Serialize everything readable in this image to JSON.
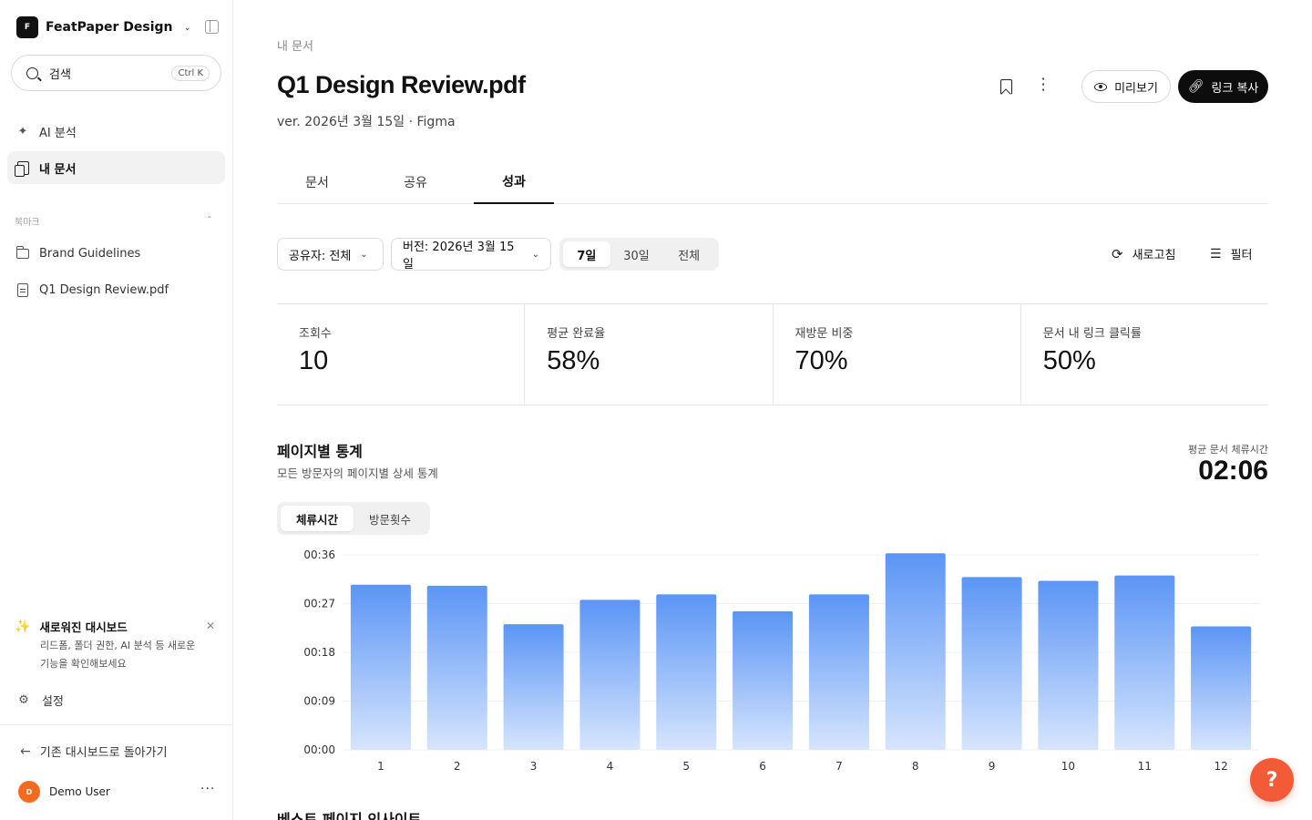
{
  "workspace": {
    "logo_letter": "F",
    "name": "FeatPaper Design"
  },
  "search": {
    "label": "검색",
    "shortcut": "Ctrl K"
  },
  "nav": {
    "ai": "AI 분석",
    "docs": "내 문서"
  },
  "bookmarks": {
    "label": "북마크",
    "items": [
      "Brand Guidelines",
      "Q1 Design Review.pdf"
    ]
  },
  "promo": {
    "title": "새로워진 대시보드",
    "desc": "리드폼, 폴더 권한, AI 분석 등 새로운 기능을 확인해보세요"
  },
  "settings_label": "설정",
  "back_label": "기존 대시보드로 돌아가기",
  "user": {
    "initial": "D",
    "name": "Demo User"
  },
  "page": {
    "breadcrumb": "내 문서",
    "title": "Q1 Design Review.pdf",
    "subtitle": "ver. 2026년 3월 15일 · Figma",
    "preview_label": "미리보기",
    "copy_link_label": "링크 복사"
  },
  "tabs": [
    "문서",
    "공유",
    "성과"
  ],
  "active_tab": "성과",
  "filters": {
    "sharer": "공유자: 전체",
    "version": "버전: 2026년 3월 15일",
    "periods": [
      "7일",
      "30일",
      "전체"
    ],
    "active_period": "7일",
    "refresh_label": "새로고침",
    "filter_label": "필터"
  },
  "stats": [
    {
      "label": "조회수",
      "value": "10"
    },
    {
      "label": "평균 완료율",
      "value": "58%"
    },
    {
      "label": "재방문 비중",
      "value": "70%"
    },
    {
      "label": "문서 내 링크 클릭률",
      "value": "50%"
    }
  ],
  "page_stats": {
    "title": "페이지별 통계",
    "subtitle": "모든 방문자의 페이지별 상세 통계",
    "avg_label": "평균 문서 체류시간",
    "avg_value": "02:06",
    "toggle": [
      "체류시간",
      "방문횟수"
    ],
    "active_toggle": "체류시간"
  },
  "chart_data": {
    "type": "bar",
    "categories": [
      "1",
      "2",
      "3",
      "4",
      "5",
      "6",
      "7",
      "8",
      "9",
      "10",
      "11",
      "12"
    ],
    "values": [
      30.5,
      30.3,
      23.2,
      27.7,
      28.7,
      25.6,
      28.7,
      36.3,
      31.9,
      31.2,
      32.2,
      22.8
    ],
    "value_unit": "seconds",
    "yticks": [
      "00:00",
      "00:09",
      "00:18",
      "00:27",
      "00:36"
    ],
    "ylim": [
      0,
      36
    ],
    "bar_color_top": "#5b95f5",
    "bar_color_bottom": "#d6e5fd"
  },
  "next_section_title": "베스트 페이지 인사이트",
  "help_label": "?"
}
